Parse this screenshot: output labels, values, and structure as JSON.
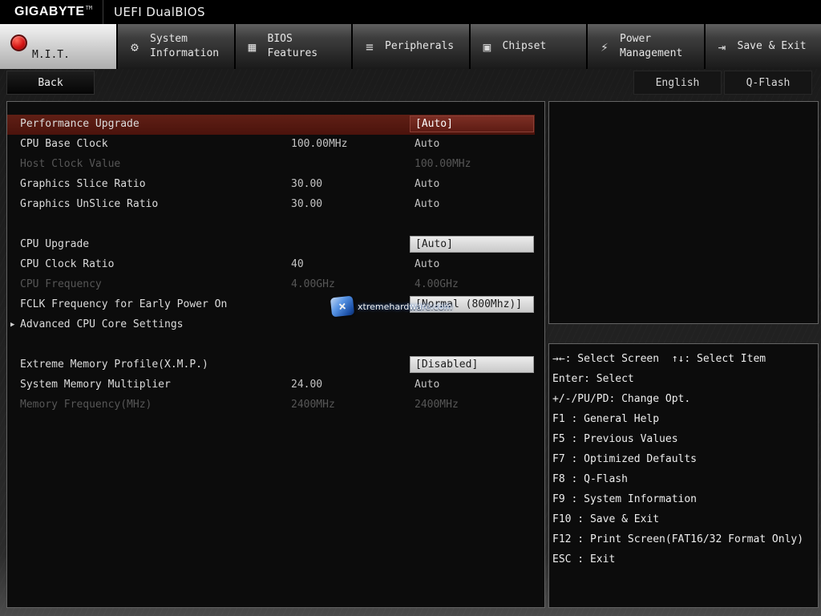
{
  "header": {
    "brand": "GIGABYTE",
    "tm": "TM",
    "title": "UEFI DualBIOS"
  },
  "tabs": {
    "mit": {
      "label": "M.I.T."
    },
    "system_information": {
      "label": "System Information",
      "glyph": "⚙"
    },
    "bios_features": {
      "label": "BIOS Features",
      "glyph": "▦"
    },
    "peripherals": {
      "label": "Peripherals",
      "glyph": "≡"
    },
    "chipset": {
      "label": "Chipset",
      "glyph": "▣"
    },
    "power_management": {
      "label": "Power Management",
      "glyph": "⚡"
    },
    "save_exit": {
      "label": "Save & Exit",
      "glyph": "⇥"
    }
  },
  "toolbar": {
    "back": "Back",
    "english": "English",
    "qflash": "Q-Flash"
  },
  "settings": {
    "submenu_arrow": "▶",
    "rows": [
      {
        "label": "Performance Upgrade",
        "mid": "",
        "value": "[Auto]"
      },
      {
        "label": "CPU Base Clock",
        "mid": "100.00MHz",
        "value": "Auto"
      },
      {
        "label": "Host Clock Value",
        "mid": "",
        "value": "100.00MHz"
      },
      {
        "label": "Graphics Slice Ratio",
        "mid": "30.00",
        "value": "Auto"
      },
      {
        "label": "Graphics UnSlice Ratio",
        "mid": "30.00",
        "value": "Auto"
      },
      {
        "label": "CPU Upgrade",
        "mid": "",
        "value": "[Auto]"
      },
      {
        "label": "CPU Clock Ratio",
        "mid": "40",
        "value": "Auto"
      },
      {
        "label": "CPU Frequency",
        "mid": "4.00GHz",
        "value": "4.00GHz"
      },
      {
        "label": "FCLK Frequency for Early Power On",
        "mid": "",
        "value": "[Normal (800Mhz)]"
      },
      {
        "label": "Advanced CPU Core Settings",
        "mid": "",
        "value": ""
      },
      {
        "label": "Extreme Memory Profile(X.M.P.)",
        "mid": "",
        "value": "[Disabled]"
      },
      {
        "label": "System Memory Multiplier",
        "mid": "24.00",
        "value": "Auto"
      },
      {
        "label": "Memory Frequency(MHz)",
        "mid": "2400MHz",
        "value": "2400MHz"
      }
    ]
  },
  "help": {
    "lines": [
      "→←: Select Screen  ↑↓: Select Item",
      "Enter: Select",
      "+/-/PU/PD: Change Opt.",
      "F1 : General Help",
      "F5 : Previous Values",
      "F7 : Optimized Defaults",
      "F8 : Q-Flash",
      "F9 : System Information",
      "F10 : Save & Exit",
      "F12 : Print Screen(FAT16/32 Format Only)",
      "ESC : Exit"
    ]
  },
  "watermark": {
    "text": "xtremehardware.com",
    "logo_glyph": "×"
  },
  "colors": {
    "highlight": "#5e1c14",
    "value_box": "#d9d9d9",
    "disabled_text": "#565656",
    "accent_red": "#d41414"
  }
}
